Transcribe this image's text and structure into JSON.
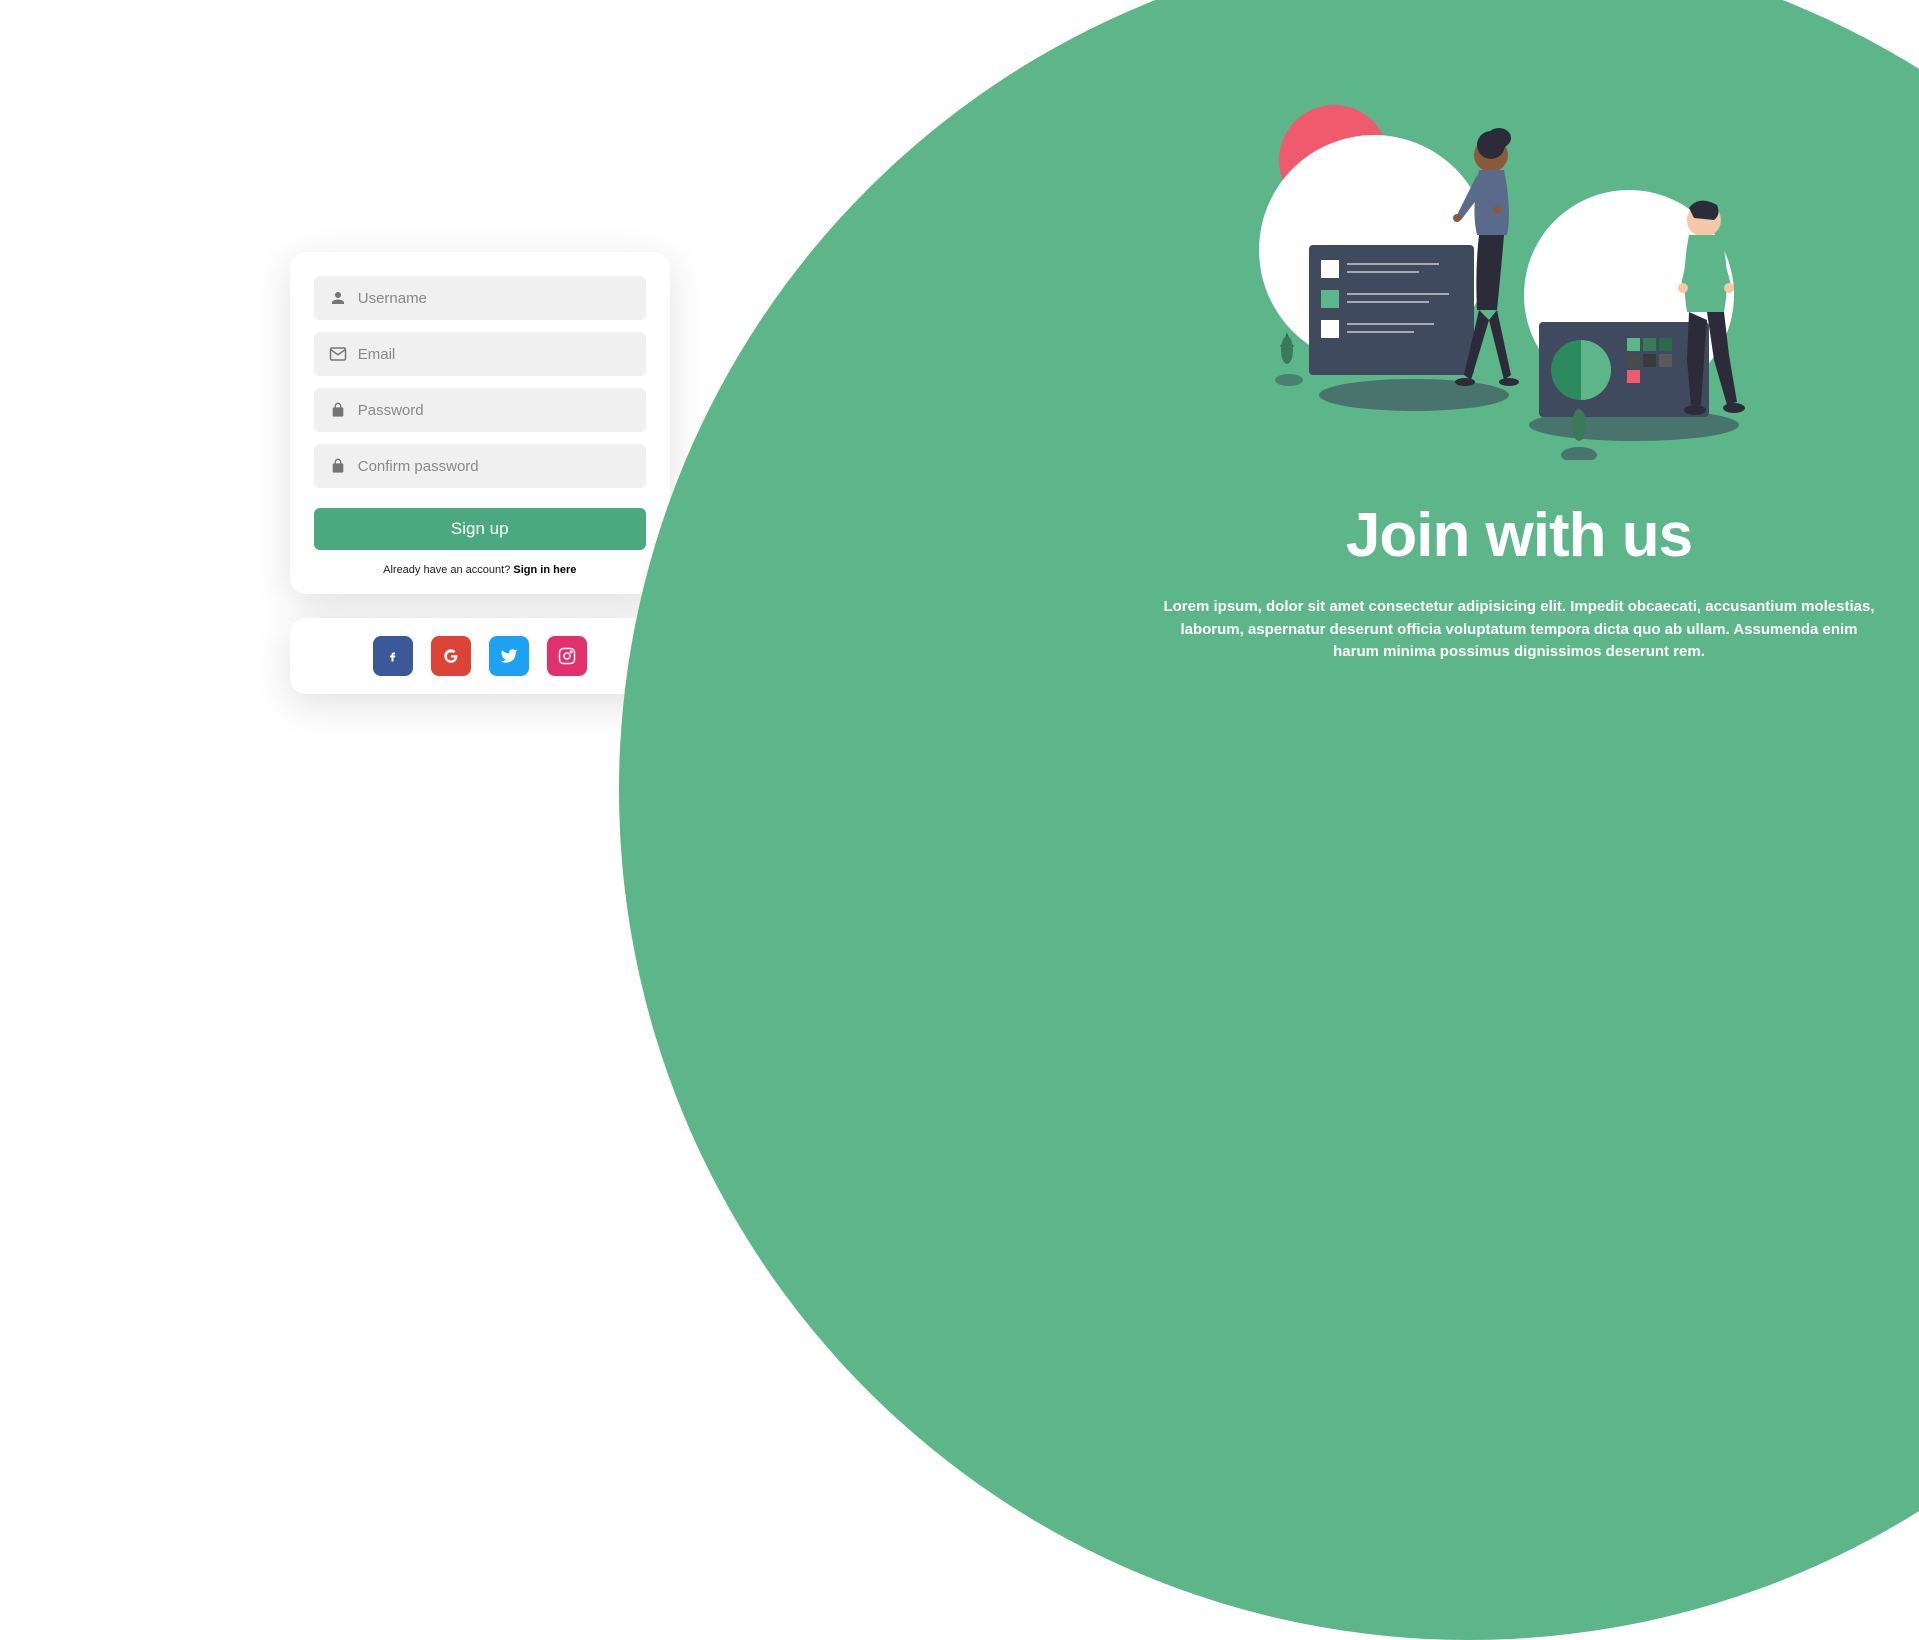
{
  "form": {
    "username_placeholder": "Username",
    "email_placeholder": "Email",
    "password_placeholder": "Password",
    "confirm_placeholder": "Confirm password",
    "signup_button": "Sign up",
    "already_text": "Already have an account? ",
    "signin_link": "Sign in here"
  },
  "social": {
    "facebook": "facebook-icon",
    "google": "google-icon",
    "twitter": "twitter-icon",
    "instagram": "instagram-icon"
  },
  "hero": {
    "title": "Join with us",
    "description": "Lorem ipsum, dolor sit amet consectetur adipisicing elit. Impedit obcaecati, accusantium molestias, laborum, aspernatur deserunt officia voluptatum tempora dicta quo ab ullam. Assumenda enim harum minima possimus dignissimos deserunt rem."
  },
  "colors": {
    "primary": "#5db58a",
    "button": "#4aa97f",
    "facebook": "#3b5998",
    "google": "#db4437",
    "twitter": "#1da1f2",
    "instagram": "#e1306c",
    "pink_accent": "#f05a6f"
  }
}
